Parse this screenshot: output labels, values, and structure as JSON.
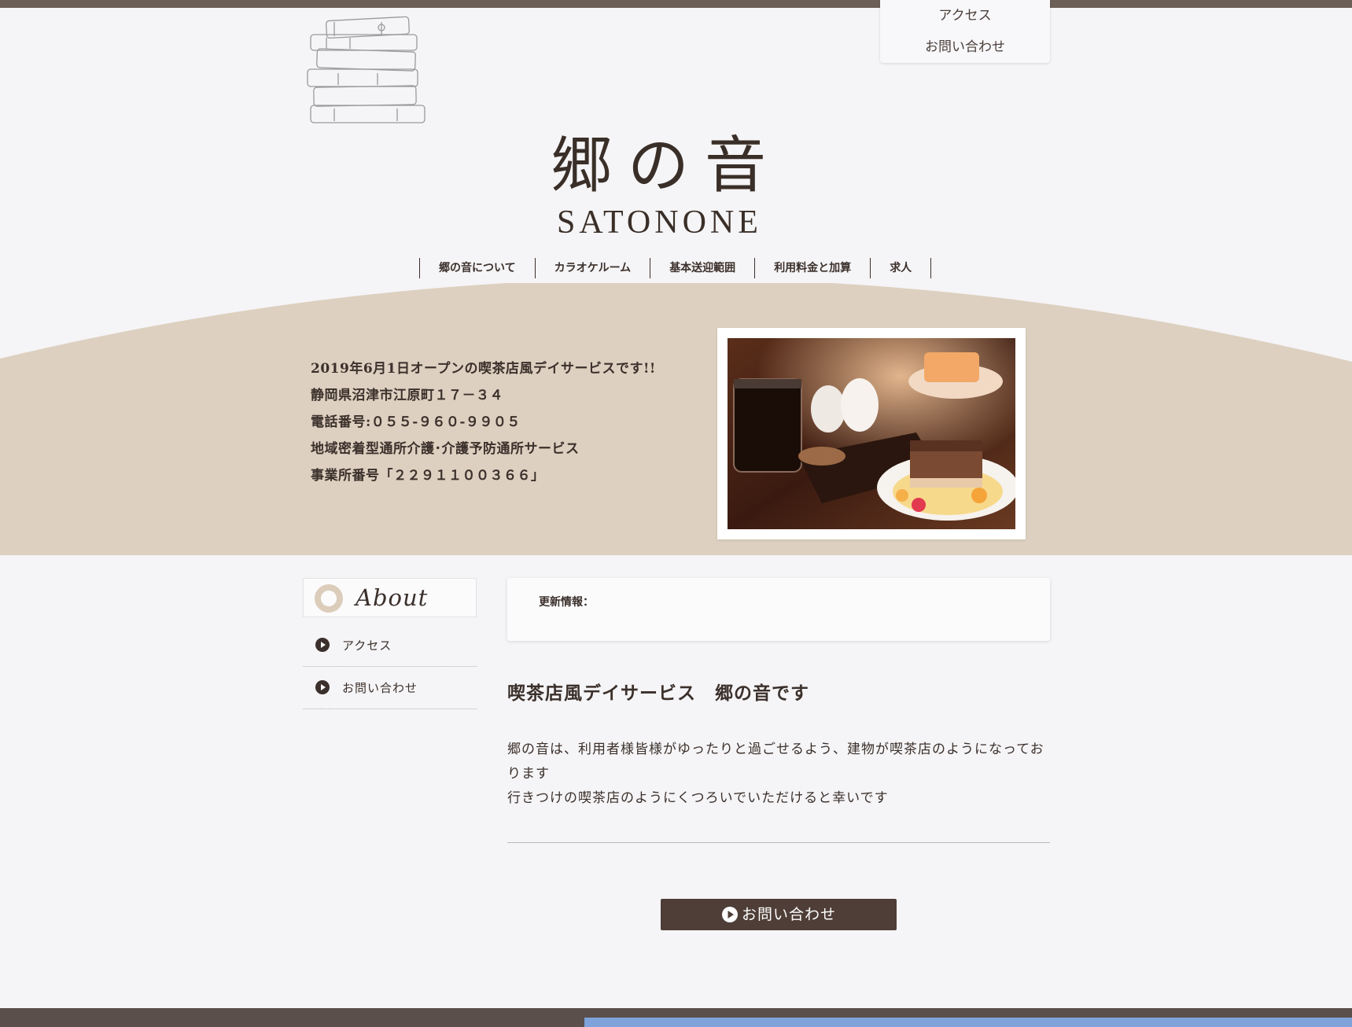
{
  "top_menu": {
    "items": [
      {
        "label": "アクセス"
      },
      {
        "label": "お問い合わせ"
      }
    ]
  },
  "logo": {
    "jp": "郷の音",
    "en": "SATONONE"
  },
  "global_nav": {
    "items": [
      {
        "label": "郷の音について"
      },
      {
        "label": "カラオケルーム"
      },
      {
        "label": "基本送迎範囲"
      },
      {
        "label": "利用料金と加算"
      },
      {
        "label": "求人"
      }
    ]
  },
  "hero": {
    "lines": [
      "2019年6月1日オープンの喫茶店風デイサービスです!!",
      "静岡県沼津市江原町１７－３４",
      "電話番号:０５５-９６０-９９０５",
      "地域密着型通所介護･介護予防通所サービス",
      "事業所番号「２２９１１００３６６」"
    ]
  },
  "sidebar": {
    "title": "About",
    "items": [
      {
        "label": "アクセス"
      },
      {
        "label": "お問い合わせ"
      }
    ]
  },
  "news": {
    "label": "更新情報："
  },
  "main": {
    "heading": "喫茶店風デイサービス　郷の音です",
    "paragraphs": [
      "郷の音は、利用者様皆様がゆったりと過ごせるよう、建物が喫茶店のようになっております",
      "行きつけの喫茶店のようにくつろいでいただけると幸いです"
    ],
    "contact_button": "お問い合わせ"
  },
  "colors": {
    "brand_dark": "#4e3e37",
    "beige_band": "#ddd0c0",
    "page_bg": "#f5f4f6",
    "footer_blue": "#7ea2d9"
  },
  "icons": {
    "play": "play-circle-icon",
    "ring": "ring-icon",
    "books": "books-illustration"
  }
}
